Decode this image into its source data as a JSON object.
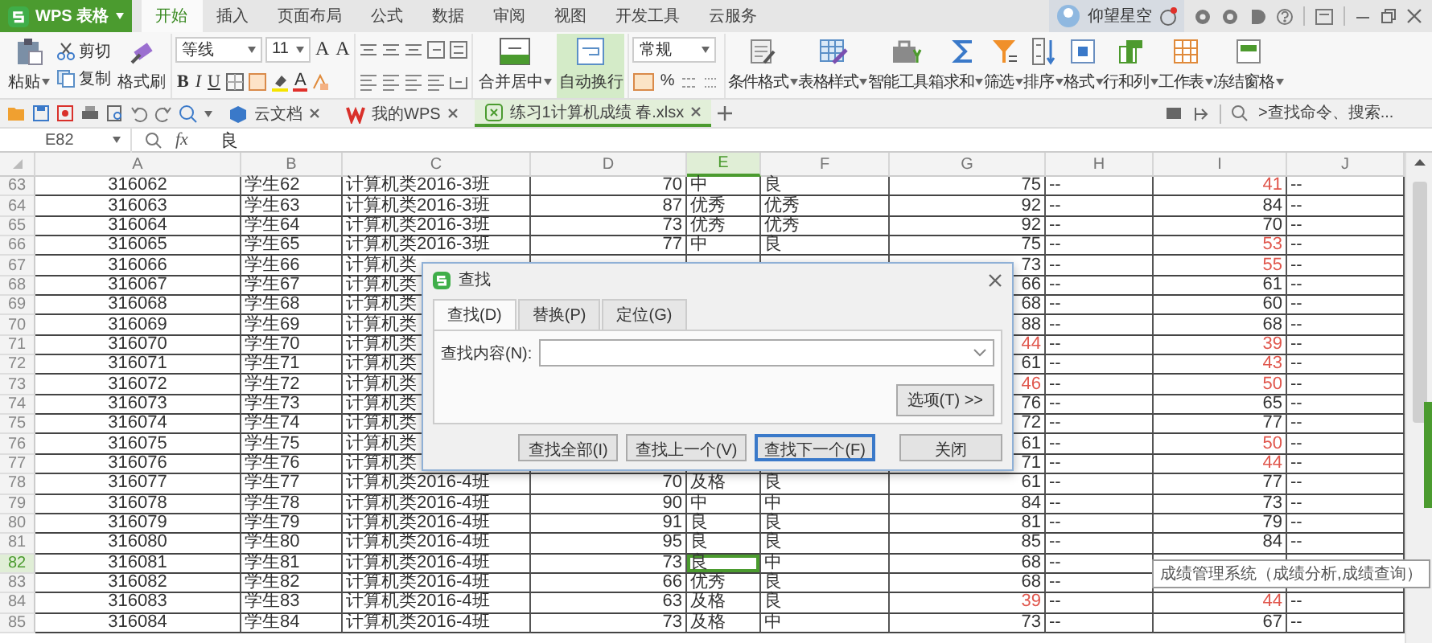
{
  "app": {
    "title": "WPS 表格"
  },
  "menu_tabs": [
    {
      "label": "开始",
      "selected": true
    },
    {
      "label": "插入",
      "selected": false
    },
    {
      "label": "页面布局",
      "selected": false
    },
    {
      "label": "公式",
      "selected": false
    },
    {
      "label": "数据",
      "selected": false
    },
    {
      "label": "审阅",
      "selected": false
    },
    {
      "label": "视图",
      "selected": false
    },
    {
      "label": "开发工具",
      "selected": false
    },
    {
      "label": "云服务",
      "selected": false
    }
  ],
  "user": {
    "name": "仰望星空"
  },
  "ribbon": {
    "paste": "粘贴",
    "cut": "剪切",
    "copy": "复制",
    "format_painter": "格式刷",
    "font": {
      "name": "等线",
      "size": "11",
      "size_buttons": [
        "A",
        "A"
      ],
      "styles": [
        "B",
        "I",
        "U"
      ],
      "color_button": "A"
    },
    "merge": "合并居中",
    "wrap": {
      "label": "自动换行",
      "on": true
    },
    "number_format": "常规",
    "percent": "%",
    "tools": [
      {
        "label": "条件格式",
        "dropdown": true
      },
      {
        "label": "表格样式",
        "dropdown": true
      },
      {
        "label": "智能工具箱",
        "dropdown": false
      },
      {
        "label": "求和",
        "dropdown": true
      },
      {
        "label": "筛选",
        "dropdown": true
      },
      {
        "label": "排序",
        "dropdown": true
      },
      {
        "label": "格式",
        "dropdown": true
      },
      {
        "label": "行和列",
        "dropdown": true
      },
      {
        "label": "工作表",
        "dropdown": true
      },
      {
        "label": "冻结窗格",
        "dropdown": true
      }
    ]
  },
  "doc_tabs": [
    {
      "label": "云文档",
      "selected": false
    },
    {
      "label": "我的WPS",
      "selected": false
    },
    {
      "label": "练习1计算机成绩 春.xlsx",
      "selected": true
    }
  ],
  "command_search": {
    "placeholder": ">查找命令、搜索..."
  },
  "formula_bar": {
    "cell": "E82",
    "function_label": "fx",
    "formula": "良"
  },
  "sheet": {
    "columns": [
      {
        "label": "A",
        "selected": false
      },
      {
        "label": "B",
        "selected": false
      },
      {
        "label": "C",
        "selected": false
      },
      {
        "label": "D",
        "selected": false
      },
      {
        "label": "E",
        "selected": true
      },
      {
        "label": "F",
        "selected": false
      },
      {
        "label": "G",
        "selected": false
      },
      {
        "label": "H",
        "selected": false
      },
      {
        "label": "I",
        "selected": false
      },
      {
        "label": "J",
        "selected": false
      }
    ],
    "rows": [
      {
        "number": "63",
        "selected": false,
        "cells": [
          "316062",
          "学生62",
          "计算机类2016-3班",
          "70",
          "中",
          "良",
          "75",
          "--",
          {
            "text": "41",
            "color": "#e0564c"
          },
          "--"
        ]
      },
      {
        "number": "64",
        "selected": false,
        "cells": [
          "316063",
          "学生63",
          "计算机类2016-3班",
          "87",
          "优秀",
          "优秀",
          "92",
          "--",
          "84",
          "--"
        ]
      },
      {
        "number": "65",
        "selected": false,
        "cells": [
          "316064",
          "学生64",
          "计算机类2016-3班",
          "73",
          "优秀",
          "优秀",
          "92",
          "--",
          "70",
          "--"
        ]
      },
      {
        "number": "66",
        "selected": false,
        "cells": [
          "316065",
          "学生65",
          "计算机类2016-3班",
          "77",
          "中",
          "良",
          "75",
          "--",
          {
            "text": "53",
            "color": "#e0564c"
          },
          "--"
        ]
      },
      {
        "number": "67",
        "selected": false,
        "cells": [
          "316066",
          "学生66",
          "计算机类",
          null,
          null,
          null,
          "73",
          "--",
          {
            "text": "55",
            "color": "#e0564c"
          },
          "--"
        ]
      },
      {
        "number": "68",
        "selected": false,
        "cells": [
          "316067",
          "学生67",
          "计算机类",
          null,
          null,
          null,
          "66",
          "--",
          "61",
          "--"
        ]
      },
      {
        "number": "69",
        "selected": false,
        "cells": [
          "316068",
          "学生68",
          "计算机类",
          null,
          null,
          null,
          "68",
          "--",
          "60",
          "--"
        ]
      },
      {
        "number": "70",
        "selected": false,
        "cells": [
          "316069",
          "学生69",
          "计算机类",
          null,
          null,
          null,
          "88",
          "--",
          "68",
          "--"
        ]
      },
      {
        "number": "71",
        "selected": false,
        "cells": [
          "316070",
          "学生70",
          "计算机类",
          null,
          null,
          null,
          {
            "text": "44",
            "color": "#e0564c"
          },
          "--",
          {
            "text": "39",
            "color": "#e0564c"
          },
          "--"
        ]
      },
      {
        "number": "72",
        "selected": false,
        "cells": [
          "316071",
          "学生71",
          "计算机类",
          null,
          null,
          null,
          "61",
          "--",
          {
            "text": "43",
            "color": "#e0564c"
          },
          "--"
        ]
      },
      {
        "number": "73",
        "selected": false,
        "cells": [
          "316072",
          "学生72",
          "计算机类",
          null,
          null,
          null,
          {
            "text": "46",
            "color": "#e0564c"
          },
          "--",
          {
            "text": "50",
            "color": "#e0564c"
          },
          "--"
        ]
      },
      {
        "number": "74",
        "selected": false,
        "cells": [
          "316073",
          "学生73",
          "计算机类",
          null,
          null,
          null,
          "76",
          "--",
          "65",
          "--"
        ]
      },
      {
        "number": "75",
        "selected": false,
        "cells": [
          "316074",
          "学生74",
          "计算机类",
          null,
          null,
          null,
          "72",
          "--",
          "77",
          "--"
        ]
      },
      {
        "number": "76",
        "selected": false,
        "cells": [
          "316075",
          "学生75",
          "计算机类",
          null,
          null,
          null,
          "61",
          "--",
          {
            "text": "50",
            "color": "#e0564c"
          },
          "--"
        ]
      },
      {
        "number": "77",
        "selected": false,
        "cells": [
          "316076",
          "学生76",
          "计算机类",
          null,
          null,
          null,
          "71",
          "--",
          {
            "text": "44",
            "color": "#e0564c"
          },
          "--"
        ]
      },
      {
        "number": "78",
        "selected": false,
        "cells": [
          "316077",
          "学生77",
          "计算机类2016-4班",
          "70",
          "及格",
          "良",
          "61",
          "--",
          "77",
          "--"
        ]
      },
      {
        "number": "79",
        "selected": false,
        "cells": [
          "316078",
          "学生78",
          "计算机类2016-4班",
          "90",
          "中",
          "中",
          "84",
          "--",
          "73",
          "--"
        ]
      },
      {
        "number": "80",
        "selected": false,
        "cells": [
          "316079",
          "学生79",
          "计算机类2016-4班",
          "91",
          "良",
          "良",
          "81",
          "--",
          "79",
          "--"
        ]
      },
      {
        "number": "81",
        "selected": false,
        "cells": [
          "316080",
          "学生80",
          "计算机类2016-4班",
          "95",
          "良",
          "良",
          "85",
          "--",
          "84",
          "--"
        ]
      },
      {
        "number": "82",
        "selected": true,
        "cells": [
          "316081",
          "学生81",
          "计算机类2016-4班",
          "73",
          "良",
          "中",
          "68",
          "--",
          null,
          null
        ]
      },
      {
        "number": "83",
        "selected": false,
        "cells": [
          "316082",
          "学生82",
          "计算机类2016-4班",
          "66",
          "优秀",
          "良",
          "68",
          "--",
          null,
          null
        ]
      },
      {
        "number": "84",
        "selected": false,
        "cells": [
          "316083",
          "学生83",
          "计算机类2016-4班",
          "63",
          "及格",
          "良",
          {
            "text": "39",
            "color": "#e0564c"
          },
          "--",
          {
            "text": "44",
            "color": "#e0564c"
          },
          "--"
        ]
      },
      {
        "number": "85",
        "selected": false,
        "cells": [
          "316084",
          "学生84",
          "计算机类2016-4班",
          "73",
          "及格",
          "中",
          "73",
          "--",
          "67",
          "--"
        ]
      }
    ]
  },
  "find_dialog": {
    "title": "查找",
    "tabs": [
      {
        "label": "查找(D)",
        "selected": true
      },
      {
        "label": "替换(P)",
        "selected": false
      },
      {
        "label": "定位(G)",
        "selected": false
      }
    ],
    "field_label": "查找内容(N):",
    "options_button": "选项(T) >>",
    "buttons": [
      {
        "label": "查找全部(I)",
        "focused": false
      },
      {
        "label": "查找上一个(V)",
        "focused": false
      },
      {
        "label": "查找下一个(F)",
        "focused": true
      },
      {
        "label": "关闭",
        "focused": false
      }
    ]
  },
  "tooltip": "成绩管理系统（成绩分析,成绩查询）"
}
